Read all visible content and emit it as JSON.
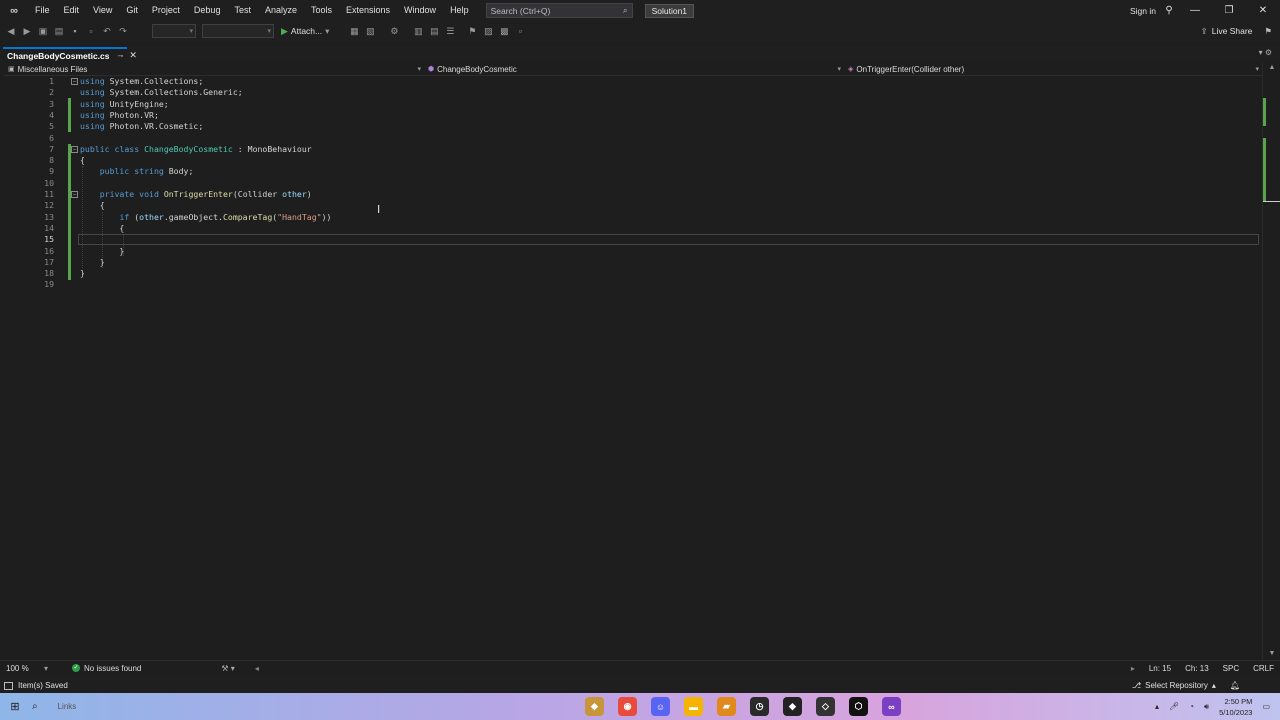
{
  "menubar": {
    "items": [
      "File",
      "Edit",
      "View",
      "Git",
      "Project",
      "Debug",
      "Test",
      "Analyze",
      "Tools",
      "Extensions",
      "Window",
      "Help"
    ],
    "search_placeholder": "Search (Ctrl+Q)",
    "solution": "Solution1",
    "sign_in": "Sign in"
  },
  "toolbar": {
    "attach_label": "Attach...",
    "live_share": "Live Share"
  },
  "tab": {
    "filename": "ChangeBodyCosmetic.cs"
  },
  "navbar": {
    "project": "Miscellaneous Files",
    "class": "ChangeBodyCosmetic",
    "member": "OnTriggerEnter(Collider other)"
  },
  "code": {
    "current_line": 15,
    "lines": [
      {
        "n": "1",
        "tokens": [
          [
            "kw",
            "using"
          ],
          [
            "pl",
            " System.Collections;"
          ]
        ]
      },
      {
        "n": "2",
        "tokens": [
          [
            "kw",
            "using"
          ],
          [
            "pl",
            " System.Collections.Generic;"
          ]
        ]
      },
      {
        "n": "3",
        "tokens": [
          [
            "kw",
            "using"
          ],
          [
            "pl",
            " UnityEngine;"
          ]
        ]
      },
      {
        "n": "4",
        "tokens": [
          [
            "kw",
            "using"
          ],
          [
            "pl",
            " Photon.VR;"
          ]
        ]
      },
      {
        "n": "5",
        "tokens": [
          [
            "kw",
            "using"
          ],
          [
            "pl",
            " Photon.VR.Cosmetic;"
          ]
        ]
      },
      {
        "n": "6",
        "tokens": []
      },
      {
        "n": "7",
        "tokens": [
          [
            "kw",
            "public"
          ],
          [
            "pl",
            " "
          ],
          [
            "kw",
            "class"
          ],
          [
            "pl",
            " "
          ],
          [
            "ty",
            "ChangeBodyCosmetic"
          ],
          [
            "pl",
            " : "
          ],
          [
            "pl",
            "MonoBehaviour"
          ]
        ]
      },
      {
        "n": "8",
        "tokens": [
          [
            "pl",
            "{"
          ]
        ]
      },
      {
        "n": "9",
        "tokens": [
          [
            "pl",
            "    "
          ],
          [
            "kw",
            "public"
          ],
          [
            "pl",
            " "
          ],
          [
            "kw",
            "string"
          ],
          [
            "pl",
            " Body;"
          ]
        ]
      },
      {
        "n": "10",
        "tokens": []
      },
      {
        "n": "11",
        "tokens": [
          [
            "pl",
            "    "
          ],
          [
            "kw",
            "private"
          ],
          [
            "pl",
            " "
          ],
          [
            "kw",
            "void"
          ],
          [
            "pl",
            " "
          ],
          [
            "fn",
            "OnTriggerEnter"
          ],
          [
            "pl",
            "(Collider "
          ],
          [
            "pa",
            "other"
          ],
          [
            "pl",
            ")"
          ]
        ]
      },
      {
        "n": "12",
        "tokens": [
          [
            "pl",
            "    {"
          ]
        ]
      },
      {
        "n": "13",
        "tokens": [
          [
            "pl",
            "        "
          ],
          [
            "kw",
            "if"
          ],
          [
            "pl",
            " ("
          ],
          [
            "pa",
            "other"
          ],
          [
            "pl",
            ".gameObject."
          ],
          [
            "fn",
            "CompareTag"
          ],
          [
            "pl",
            "("
          ],
          [
            "str",
            "\"HandTag\""
          ],
          [
            "pl",
            "))"
          ]
        ]
      },
      {
        "n": "14",
        "tokens": [
          [
            "pl",
            "        {"
          ]
        ]
      },
      {
        "n": "15",
        "tokens": []
      },
      {
        "n": "16",
        "tokens": [
          [
            "pl",
            "        }"
          ]
        ]
      },
      {
        "n": "17",
        "tokens": [
          [
            "pl",
            "    }"
          ]
        ]
      },
      {
        "n": "18",
        "tokens": [
          [
            "pl",
            "}"
          ]
        ]
      },
      {
        "n": "19",
        "tokens": []
      }
    ]
  },
  "editor_status": {
    "zoom": "100 %",
    "issues": "No issues found",
    "line": "Ln: 15",
    "col": "Ch: 13",
    "whitespace": "SPC",
    "eol": "CRLF"
  },
  "status": {
    "message": "Item(s) Saved",
    "select_repo": "Select Repository"
  },
  "taskbar": {
    "search_placeholder": "Links",
    "time": "2:50 PM",
    "date": "5/10/2023",
    "apps": [
      {
        "icon": "app-icon",
        "color": "#c8953a"
      },
      {
        "icon": "chrome-icon",
        "color": "#e84b3c"
      },
      {
        "icon": "discord-icon",
        "color": "#5865f2"
      },
      {
        "icon": "file-explorer-icon",
        "color": "#f4b400"
      },
      {
        "icon": "folder-icon",
        "color": "#e08a1e"
      },
      {
        "icon": "clock-icon",
        "color": "#2a2a2a"
      },
      {
        "icon": "app-icon",
        "color": "#222222"
      },
      {
        "icon": "unity-icon",
        "color": "#333333"
      },
      {
        "icon": "unity-hub-icon",
        "color": "#111111"
      },
      {
        "icon": "visual-studio-icon",
        "color": "#7b3fc4"
      }
    ]
  }
}
